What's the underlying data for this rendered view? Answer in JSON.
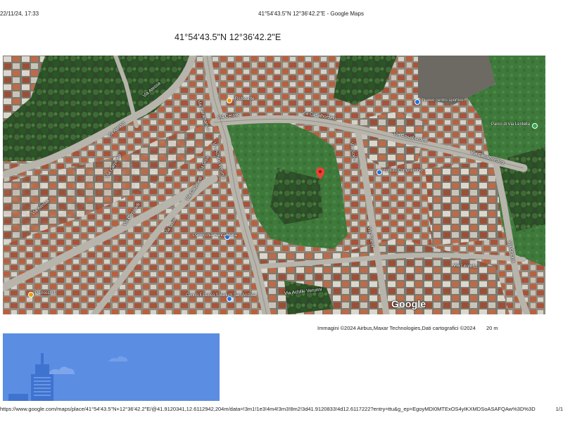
{
  "print_header": {
    "datetime": "22/11/24, 17:33",
    "title": "41°54'43.5\"N 12°36'42.2\"E - Google Maps"
  },
  "place": {
    "coordinates": "41°54'43.5\"N 12°36'42.2\"E"
  },
  "map": {
    "view": "satellite",
    "streets": {
      "via_atessa_1": "Via Atessa",
      "via_atessa_2": "Via Atessa",
      "via_atessa_3": "Via Atessa",
      "via_ceraso": "Via Ceraso",
      "via_casalbordino_1": "Via Casalbordino",
      "via_casalbordino_2": "Via Casalbordino",
      "via_casalbordino_3": "Via Casalbordino",
      "via_achille_verunni_1": "Via Achille Verunni",
      "via_achille_verunni_2": "Via Achille Verunni",
      "via_caramanico": "Via Caramanico",
      "via_carpinelli_1": "Via Carpinelli",
      "via_carpinelli_2": "Via Carpinelli",
      "via_carpinelli_3": "Via Carpinelli",
      "via_gissi_1": "Via Gissi",
      "via_gissi_2": "Via Gissi",
      "via_scerni_1": "Via Scerni",
      "via_scerni_2": "Via Scerni",
      "via_ortona": "Via Ortona",
      "via_lentella": "Via Lentella"
    },
    "pois": {
      "poi_1": "Nuovo centro sportivo",
      "poi_2": "Istituto Comprensivo",
      "poi_3": "Parrocchia",
      "poi_4": "Ristorante",
      "poi_5": "Parrocchia Santa Maria",
      "poi_6": "Centro Estetico Solarium San Andrea",
      "poi_7": "Parco di Via Lentella"
    },
    "logo": "Google",
    "selected_pin": "red-location-pin"
  },
  "footer_map": {
    "attribution": "Immagini ©2024 Airbus,Maxar Technologies,Dati cartografici ©2024",
    "scale": "20 m"
  },
  "thumbnail": {
    "description": "street-view-thumbnail"
  },
  "print_footer": {
    "url": "https://www.google.com/maps/place/41°54'43.5\"N+12°36'42.2\"E/@41.9120341,12.6112942,204m/data=!3m1!1e3!4m4!3m3!8m2!3d41.9120833!4d12.6117222?entry=ttu&g_ep=EgoyMDI0MTExOS4yIKXMDSoASAFQAw%3D%3D",
    "page": "1/1"
  },
  "colors": {
    "pin_red": "#ea4335",
    "poi_orange": "#f29900",
    "poi_blue": "#1a73e8",
    "poi_green": "#34a853",
    "sky_blue": "#5b8de2"
  }
}
